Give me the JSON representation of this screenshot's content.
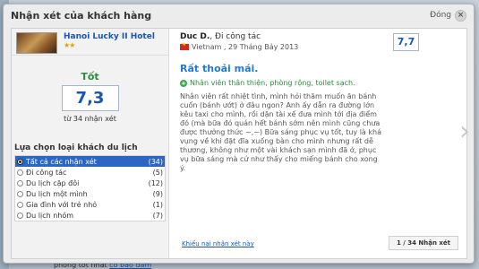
{
  "modal": {
    "title": "Nhận xét của khách hàng",
    "close_label": "Đóng"
  },
  "hotel": {
    "name": "Hanoi Lucky II Hotel",
    "stars": "★★"
  },
  "score": {
    "label": "Tốt",
    "value": "7,3",
    "count": "từ 34 nhận xét"
  },
  "filters": {
    "title": "Lựa chọn loại khách du lịch",
    "items": [
      {
        "label": "Tất cả các nhận xét",
        "count": "(34)",
        "selected": true
      },
      {
        "label": "Đi công tác",
        "count": "(5)"
      },
      {
        "label": "Du lịch cặp đôi",
        "count": "(12)"
      },
      {
        "label": "Du lịch một mình",
        "count": "(9)"
      },
      {
        "label": "Gia đình với trẻ nhỏ",
        "count": "(1)"
      },
      {
        "label": "Du lịch nhóm",
        "count": "(7)"
      }
    ]
  },
  "review": {
    "reviewer_name": "Duc D.",
    "reviewer_type": ", Đi công tác",
    "origin": "Vietnam , 29 Tháng Bảy 2013",
    "score": "7,7",
    "title": "Rất thoải mái.",
    "pros": "Nhân viên thân thiện, phòng rộng, toilet sạch.",
    "text": "Nhân viên rất nhiệt tình, mình hỏi thăm muốn ăn bánh cuốn (bánh ướt) ở đâu ngon? Anh ấy dẫn ra đường lớn kêu taxi cho mình, rồi dặn tài xế đưa mình tới địa điểm đó (mà bữa đó quán hết bánh sớm nên mình cũng chưa được thưởng thức ~,~) Bữa sáng phục vụ tốt, tuy là khá vụng về khi đặt đĩa xuống bàn cho mình nhưng rất dễ thương, không như một vài khách sạn mình đã ở, phục vụ bữa sáng mà cứ như thẩy cho miếng bánh cho xong ý.",
    "report_link": "Khiếu nại nhận xét này",
    "pager": "1 / 34 Nhận xét"
  },
  "background": {
    "bottom_text": "phòng tốt nhất",
    "bottom_link": "có bảo đảm"
  },
  "icons": {
    "close": "close-icon",
    "next": "chevron-right-icon",
    "flag": "vietnam-flag-icon",
    "plus": "plus-circle-icon"
  }
}
